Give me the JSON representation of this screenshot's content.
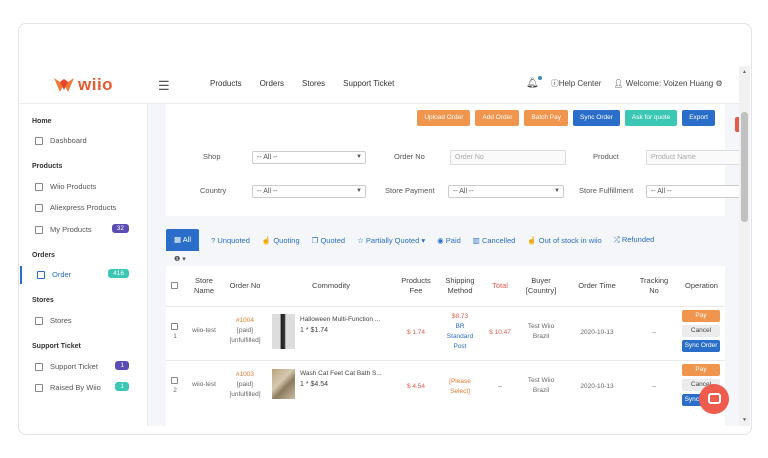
{
  "brand": {
    "logo_text": "wiio",
    "accent": "#e8592e"
  },
  "topnav": [
    "Products",
    "Orders",
    "Stores",
    "Support Ticket"
  ],
  "topright": {
    "help": "Help Center",
    "welcome": "Welcome: Voizen Huang"
  },
  "sidebar": {
    "home": "Home",
    "dashboard": "Dashboard",
    "products": "Products",
    "wiio_products": "Wiio Products",
    "aliexpress_products": "Aliexpress Products",
    "my_products": "My Products",
    "my_products_count": "32",
    "orders": "Orders",
    "order": "Order",
    "order_count": "416",
    "stores": "Stores",
    "stores_item": "Stores",
    "support": "Support Ticket",
    "support_item": "Support Ticket",
    "support_count": "1",
    "raised_by": "Raised By Wiio",
    "raised_count": "1"
  },
  "actions": {
    "upload": "Upload Order",
    "add": "Add Order",
    "batch_pay": "Batch Pay",
    "sync": "Sync Order",
    "ask": "Ask for quote",
    "export": "Export"
  },
  "filters": {
    "shop_label": "Shop",
    "shop_value": "-- All --",
    "order_no_label": "Order No",
    "order_no_placeholder": "Order No",
    "product_label": "Product",
    "product_placeholder": "Product Name",
    "country_label": "Country",
    "country_value": "-- All --",
    "store_payment_label": "Store Payment",
    "store_payment_value": "-- All --",
    "store_fulfillment_label": "Store Fulfillment",
    "store_fulfillment_value": "-- All --"
  },
  "tabs": {
    "all": "All",
    "unquoted": "Unquoted",
    "quoting": "Quoting",
    "quoted": "Quoted",
    "partially": "Partially Quoted",
    "paid": "Paid",
    "cancelled": "Cancelled",
    "out_of_stock": "Out of stock in wiio",
    "refunded": "Refunded"
  },
  "table": {
    "headers": {
      "store_name_1": "Store",
      "store_name_2": "Name",
      "order_no": "Order No",
      "commodity": "Commodity",
      "fee_1": "Products",
      "fee_2": "Fee",
      "ship_1": "Shipping",
      "ship_2": "Method",
      "total": "Total",
      "buyer_1": "Buyer",
      "buyer_2": "[Country]",
      "order_time": "Order Time",
      "tracking_1": "Tracking",
      "tracking_2": "No",
      "operation": "Operation"
    },
    "rows": [
      {
        "idx": "1",
        "store": "wiio-test",
        "order_no": "#1004",
        "status1": "[paid]",
        "status2": "[unfulfilled]",
        "title": "Halloween Multi-Function ...",
        "qty_price": "1 * $1.74",
        "fee": "$ 1.74",
        "ship_price": "$8.73",
        "ship_line1": "BR",
        "ship_line2": "Standard",
        "ship_line3": "Post",
        "total": "$ 10.47",
        "buyer": "Test Wiio",
        "country": "Brazil",
        "time": "2020-10-13",
        "tracking": "--",
        "op1": "Pay",
        "op2": "Cancel",
        "op3": "Sync Order"
      },
      {
        "idx": "2",
        "store": "wiio-test",
        "order_no": "#1003",
        "status1": "[paid]",
        "status2": "[unfulfilled]",
        "title": "Wash Cat Feet Cat Bath S...",
        "qty_price": "1 * $4.54",
        "fee": "$ 4.54",
        "ship_line1": "[Please",
        "ship_line2": "Select]",
        "total": "--",
        "buyer": "Test Wiio",
        "country": "Brazil",
        "time": "2020-10-13",
        "tracking": "--",
        "op1": "Pay",
        "op2": "Cancel",
        "op3": "Sync Order"
      }
    ]
  }
}
